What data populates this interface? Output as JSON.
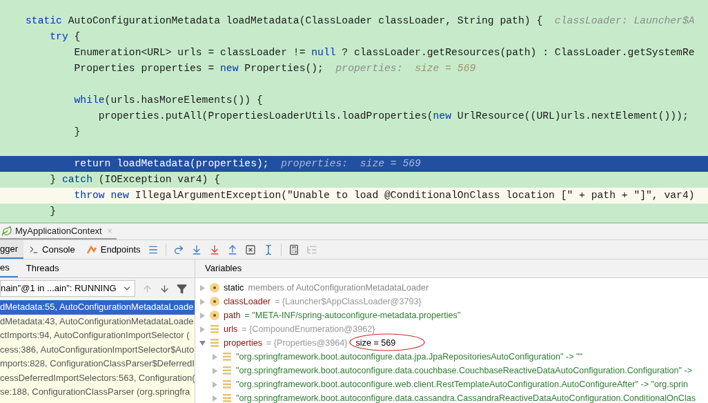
{
  "editor": {
    "lines": [
      {
        "kind": "normal",
        "tokens": [
          {
            "kind": "kw",
            "text": "static"
          },
          {
            "kind": "text",
            "text": " AutoConfigurationMetadata loadMetadata(ClassLoader classLoader, String path) {  "
          },
          {
            "kind": "hint",
            "text": "classLoader: Launcher$A"
          }
        ]
      },
      {
        "kind": "normal",
        "tokens": [
          {
            "kind": "kw",
            "text": "    try"
          },
          {
            "kind": "text",
            "text": " {"
          }
        ]
      },
      {
        "kind": "normal",
        "tokens": [
          {
            "kind": "text",
            "text": "        Enumeration<URL> urls = classLoader != "
          },
          {
            "kind": "kw",
            "text": "null"
          },
          {
            "kind": "text",
            "text": " ? classLoader.getResources(path) : ClassLoader.getSystemRe"
          }
        ]
      },
      {
        "kind": "normal",
        "tokens": [
          {
            "kind": "text",
            "text": "        Properties properties = "
          },
          {
            "kind": "kw",
            "text": "new"
          },
          {
            "kind": "text",
            "text": " Properties();  "
          },
          {
            "kind": "hint",
            "text": "properties:  "
          },
          {
            "kind": "hintval",
            "text": "size = 569"
          }
        ]
      },
      {
        "kind": "blank"
      },
      {
        "kind": "normal",
        "tokens": [
          {
            "kind": "kw",
            "text": "        while"
          },
          {
            "kind": "text",
            "text": "(urls.hasMoreElements()) {"
          }
        ]
      },
      {
        "kind": "normal",
        "tokens": [
          {
            "kind": "text",
            "text": "            properties.putAll(PropertiesLoaderUtils.loadProperties("
          },
          {
            "kind": "kw",
            "text": "new"
          },
          {
            "kind": "text",
            "text": " UrlResource((URL)urls.nextElement()));"
          }
        ]
      },
      {
        "kind": "normal",
        "tokens": [
          {
            "kind": "text",
            "text": "        }"
          }
        ]
      },
      {
        "kind": "blank"
      },
      {
        "kind": "current",
        "tokens": [
          {
            "kind": "kw",
            "text": "        return"
          },
          {
            "kind": "text",
            "text": " loadMetadata(properties);  "
          },
          {
            "kind": "hint",
            "text": "properties:  "
          },
          {
            "kind": "hintval",
            "text": "size = 569"
          }
        ]
      },
      {
        "kind": "normal",
        "tokens": [
          {
            "kind": "text",
            "text": "    } "
          },
          {
            "kind": "kw",
            "text": "catch"
          },
          {
            "kind": "text",
            "text": " (IOException var4) {"
          }
        ]
      },
      {
        "kind": "marked",
        "tokens": [
          {
            "kind": "kw",
            "text": "        throw new"
          },
          {
            "kind": "text",
            "text": " IllegalArgumentException(\"Unable to load @ConditionalOnClass location [\" + path + \"]\", var4)"
          }
        ]
      },
      {
        "kind": "normal",
        "tokens": [
          {
            "kind": "text",
            "text": "    }"
          }
        ]
      }
    ]
  },
  "debug_tab": {
    "title": "MyApplicationContext",
    "close": "×"
  },
  "tabs": [
    {
      "label": "gger",
      "selected": true,
      "kind": "debugger"
    },
    {
      "label": "Console",
      "selected": false,
      "kind": "console"
    },
    {
      "label": "Endpoints",
      "selected": false,
      "kind": "endpoints"
    }
  ],
  "subtabs": [
    {
      "label": "es",
      "selected": true
    },
    {
      "label": "Threads",
      "selected": false
    }
  ],
  "thread": {
    "value": "nain\"@1 in ...ain\": RUNNING"
  },
  "frames": [
    {
      "text": "dMetadata:55, AutoConfigurationMetadataLoade",
      "selected": true
    },
    {
      "text": "dMetadata:43, AutoConfigurationMetadataLoade",
      "selected": false
    },
    {
      "text": "ctImports:94, AutoConfigurationImportSelector (",
      "selected": false
    },
    {
      "text": "cess:386, AutoConfigurationImportSelector$Auto",
      "selected": false
    },
    {
      "text": "mports:828, ConfigurationClassParser$DeferredI",
      "selected": false
    },
    {
      "text": "cessDeferredImportSelectors:563, Configuration(",
      "selected": false
    },
    {
      "text": "se:188, ConfigurationClassParser (org.springfra",
      "selected": false
    }
  ],
  "variables": {
    "title": "Variables",
    "items": [
      {
        "kind": "static",
        "name": "static",
        "value": "members of AutoConfigurationMetadataLoader",
        "expanded": false
      },
      {
        "kind": "param",
        "name": "classLoader",
        "value": "= {Launcher$AppClassLoader@3793}",
        "expanded": false
      },
      {
        "kind": "param",
        "name": "path",
        "value": "= \"META-INF/spring-autoconfigure-metadata.properties\"",
        "expanded": false
      },
      {
        "kind": "field",
        "name": "urls",
        "value": "= {CompoundEnumeration@3962}",
        "expanded": false
      },
      {
        "kind": "field",
        "name": "properties",
        "value": "= {Properties@3964}",
        "note": "size = 569",
        "expanded": true,
        "children": [
          {
            "kind": "entry",
            "name": "\"org.springframework.boot.autoconfigure.data.jpa.JpaRepositoriesAutoConfiguration\" -> \"\"",
            "expanded": false
          },
          {
            "kind": "entry",
            "name": "\"org.springframework.boot.autoconfigure.data.couchbase.CouchbaseReactiveDataAutoConfiguration.Configuration\" ->",
            "expanded": false
          },
          {
            "kind": "entry",
            "name": "\"org.springframework.boot.autoconfigure.web.client.RestTemplateAutoConfiguration.AutoConfigureAfter\" -> \"org.sprin",
            "expanded": false
          },
          {
            "kind": "entry",
            "name": "\"org.springframework.boot.autoconfigure.data.cassandra.CassandraReactiveDataAutoConfiguration.ConditionalOnClas",
            "expanded": false
          }
        ]
      }
    ]
  }
}
